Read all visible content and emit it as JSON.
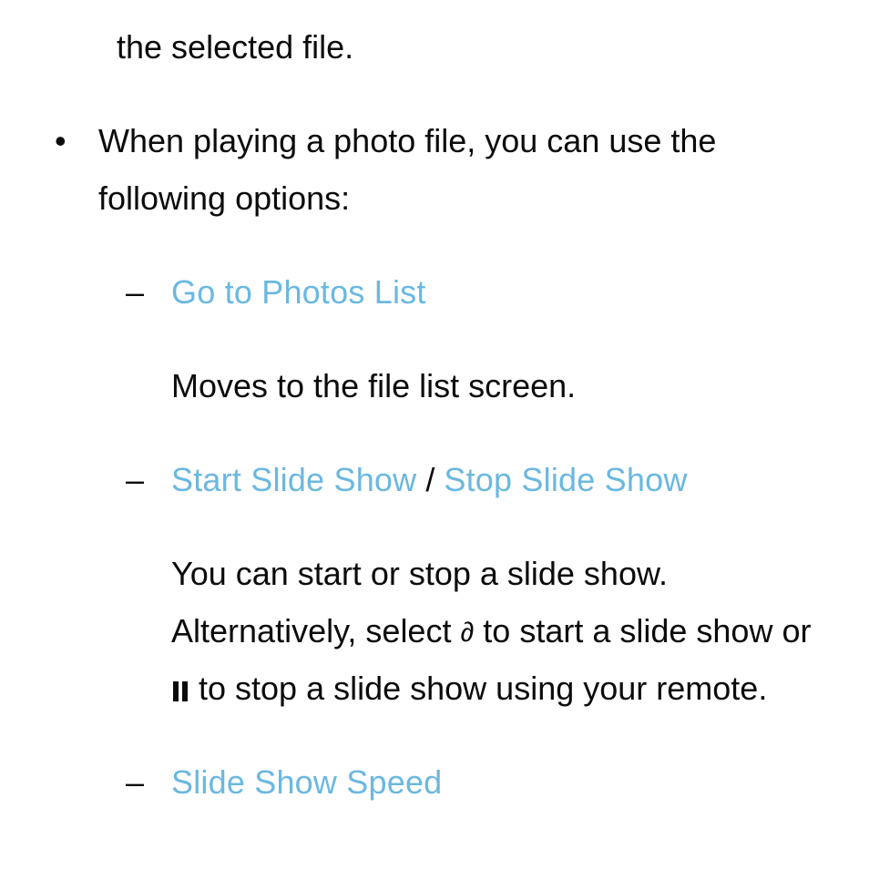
{
  "carryover_line": "the selected file.",
  "bullet_text": "When playing a photo file, you can use the following options:",
  "options": [
    {
      "title_parts": [
        "Go to Photos List"
      ],
      "desc_segments": [
        {
          "text": "Moves to the file list screen."
        }
      ]
    },
    {
      "title_parts": [
        "Start Slide Show",
        "Stop Slide Show"
      ],
      "desc_segments": [
        {
          "text": "You can start or stop a slide show. Alternatively, select "
        },
        {
          "icon": "play"
        },
        {
          "text": " to start a slide show or "
        },
        {
          "icon": "pause"
        },
        {
          "text": " to stop a slide show using your remote."
        }
      ]
    },
    {
      "title_parts": [
        "Slide Show Speed"
      ]
    }
  ],
  "separator": " / ",
  "icons": {
    "play": "∂",
    "pause": "�ο"
  }
}
